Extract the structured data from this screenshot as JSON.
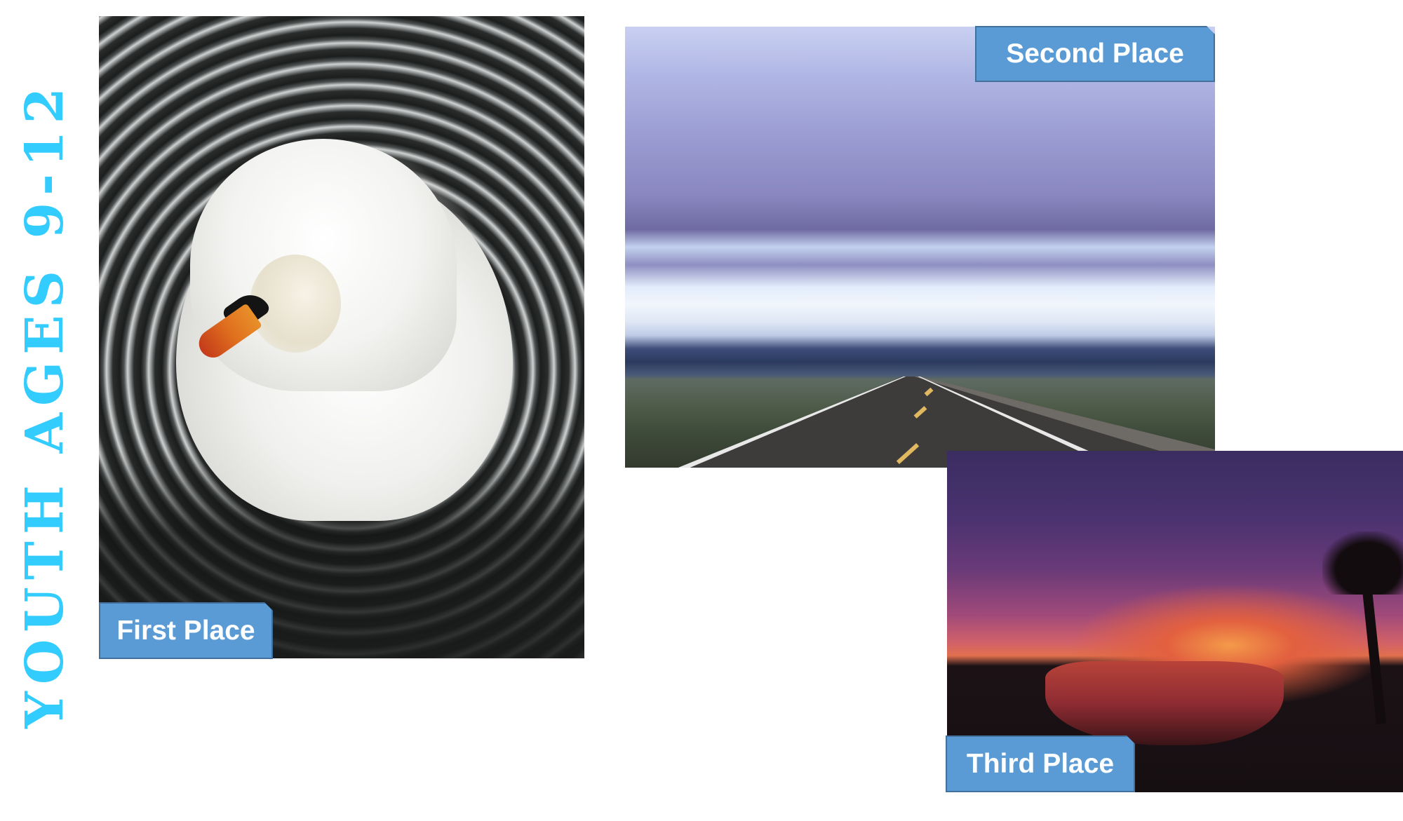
{
  "title": "YOUTH AGES 9-12",
  "colors": {
    "title": "#33CCFF",
    "label_fill": "#5B9BD5",
    "label_border": "#41719C",
    "label_text": "#FFFFFF"
  },
  "photos": [
    {
      "id": "first",
      "subject": "white swan preening on rippled dark water",
      "label": "First Place"
    },
    {
      "id": "second",
      "subject": "storm shelf cloud over a straight highway",
      "label": "Second Place"
    },
    {
      "id": "third",
      "subject": "purple and orange sunset over a lake with palm tree",
      "label": "Third Place"
    }
  ]
}
